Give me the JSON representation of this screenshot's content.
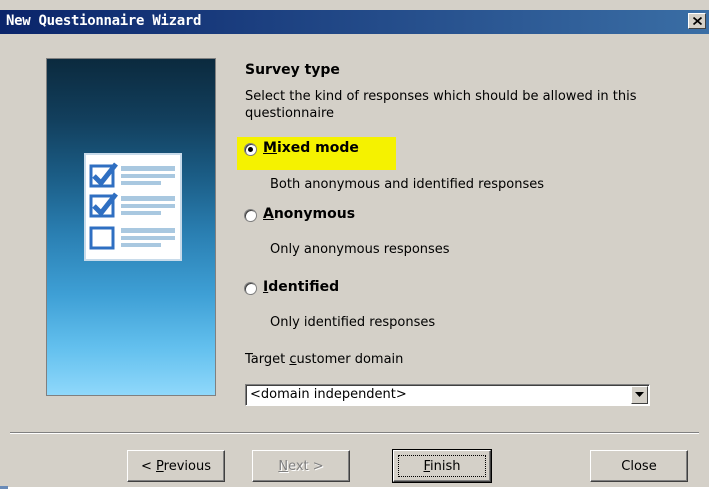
{
  "window": {
    "title": "New Questionnaire Wizard",
    "close_symbol": "✕",
    "title_color": "#0a246a",
    "face_color": "#d4d0c8",
    "highlight_color": "#f5f200"
  },
  "side_panel": {
    "icon": "checklist-document-icon"
  },
  "survey": {
    "heading": "Survey type",
    "description": "Select the kind of responses which should be allowed in this questionnaire",
    "options": [
      {
        "label": "Mixed mode",
        "description": "Both anonymous and identified responses",
        "selected": true
      },
      {
        "label": "Anonymous",
        "description": "Only anonymous responses",
        "selected": false
      },
      {
        "label": "Identified",
        "description": "Only identified responses",
        "selected": false
      }
    ]
  },
  "target": {
    "label": "Target customer domain",
    "value": "<domain independent>"
  },
  "buttons": {
    "previous": "< Previous",
    "next": "Next >",
    "finish": "Finish",
    "close": "Close"
  }
}
